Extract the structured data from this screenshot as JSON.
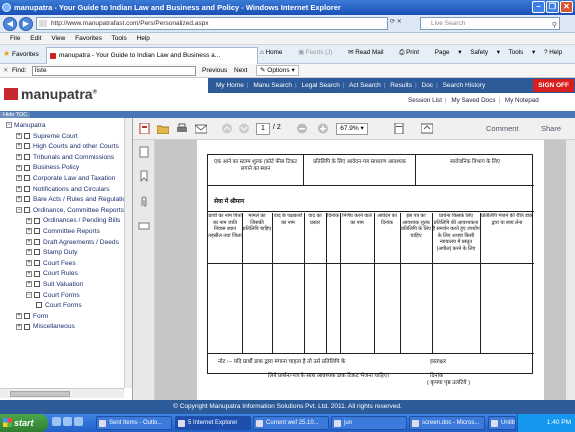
{
  "window": {
    "title": "manupatra - Your Guide to Indian Law and Business and Policy - Windows Internet Explorer"
  },
  "address": {
    "url": "http://www.manupatrafast.com/Pers/Personalized.aspx",
    "search_placeholder": "Live Search"
  },
  "menu": [
    "File",
    "Edit",
    "View",
    "Favorites",
    "Tools",
    "Help"
  ],
  "favorites_label": "Favorites",
  "tab": {
    "label": "manupatra - Your Guide to Indian Law and Business a..."
  },
  "commands": {
    "home": "Home",
    "feeds": "Feeds (J)",
    "read_mail": "Read Mail",
    "print": "Print",
    "page": "Page",
    "safety": "Safety",
    "tools": "Tools",
    "help": "Help"
  },
  "find": {
    "label": "Find:",
    "value": "liste",
    "previous": "Previous",
    "next": "Next",
    "options": "Options"
  },
  "site": {
    "logo": "manupatra",
    "nav": [
      "My Home",
      "Manu Search",
      "Legal Search",
      "Act Search",
      "Results",
      "Doc",
      "Search History"
    ],
    "sign_off": "SIGN OFF",
    "sublinks": [
      "Session List",
      "My Saved Docs",
      "My Notepad"
    ],
    "hide_toc": "Hide TOC"
  },
  "tree": [
    {
      "label": "Manupatra",
      "level": 0,
      "exp": "−",
      "cb": false
    },
    {
      "label": "Supreme Court",
      "level": 1,
      "exp": "+",
      "cb": true
    },
    {
      "label": "High Courts and other Courts",
      "level": 1,
      "exp": "+",
      "cb": true
    },
    {
      "label": "Tribunals and Commissions",
      "level": 1,
      "exp": "+",
      "cb": true
    },
    {
      "label": "Business Policy",
      "level": 1,
      "exp": "+",
      "cb": true
    },
    {
      "label": "Corporate Law and Taxation",
      "level": 1,
      "exp": "+",
      "cb": true
    },
    {
      "label": "Notifications and Circulars",
      "level": 1,
      "exp": "+",
      "cb": true
    },
    {
      "label": "Bare Acts / Rules and Regulations",
      "level": 1,
      "exp": "+",
      "cb": true
    },
    {
      "label": "Ordinance, Committee Reports",
      "level": 1,
      "exp": "−",
      "cb": true
    },
    {
      "label": "Ordinances / Pending Bills",
      "level": 2,
      "exp": "+",
      "cb": true
    },
    {
      "label": "Committee Reports",
      "level": 2,
      "exp": "+",
      "cb": true
    },
    {
      "label": "Draft Agreements / Deeds",
      "level": 2,
      "exp": "+",
      "cb": true
    },
    {
      "label": "Stamp Duty",
      "level": 2,
      "exp": "+",
      "cb": true
    },
    {
      "label": "Court Fees",
      "level": 2,
      "exp": "+",
      "cb": true
    },
    {
      "label": "Court Rules",
      "level": 2,
      "exp": "+",
      "cb": true
    },
    {
      "label": "Suit Valuation",
      "level": 2,
      "exp": "+",
      "cb": true
    },
    {
      "label": "Court Forms",
      "level": 2,
      "exp": "−",
      "cb": true
    },
    {
      "label": "Court Forms",
      "level": 3,
      "exp": "",
      "cb": true
    },
    {
      "label": "Form",
      "level": 1,
      "exp": "+",
      "cb": true
    },
    {
      "label": "Miscellaneous",
      "level": 1,
      "exp": "+",
      "cb": true
    }
  ],
  "pdf": {
    "page": "1",
    "total": "/ 2",
    "zoom": "67.9%",
    "comment": "Comment",
    "share": "Share"
  },
  "doc": {
    "h1": "एक आने का स्टाम्प शुल्क (कोर्ट फीस टिकट लगाने का स्थान",
    "h2": "प्रतिलिपि के लिए आवेदन-पत्र साधारण आवश्यक",
    "h3": "सार्वजनिक विभाग के लिए",
    "section": "सेवा में श्रीमान",
    "cols": [
      "प्रार्थी का नाम पिता का नाम जाति निवास स्थान तहसील तथा जिला",
      "मामले का जिसकी प्रतिलिपि चाहिए",
      "वाद के पक्षकारों का नाम",
      "वाद का प्रकार",
      "दिनांक",
      "निर्णय करने वाले का नाम",
      "आवेदन का दिनांक",
      "इस पत्र का आवश्यक शुल्क प्रतिलिपि के लिए चाहिए",
      "प्रार्थना किसके लिए प्रतिलिपि की आवश्यकता है समर्थन करते हुए उपयोग के लिए अथवा किसी न्यायालय में प्रस्तुत (अपील) करने के लिए",
      "प्रतिलिपि भेजने की रीति डाक द्वारा या स्वयं लेना"
    ],
    "note": "नोट :-- यदि प्रार्थी डाक द्वारा मंगाना चाहता है तो उसे प्रतिलिपि के",
    "note2": "लिये प्रार्थना-पत्र के साथ आवश्यक डाक टिकट भेजना चाहिए।",
    "sign": "हस्ताक्षर",
    "date": "दिनांक",
    "footer": "( कृपया पृष्ठ उलटिये )"
  },
  "copyright": "© Copyright Manupatra Information Solutions Pvt. Ltd. 2011. All rights reserved.",
  "taskbar": {
    "start": "start",
    "buttons": [
      "Sent Items - Outlo...",
      "5 Internet Explorer",
      "Current wef 25.10...",
      "jun",
      "screen.doc - Micros...",
      "Untitled - Paint"
    ],
    "clock": "1:40 PM"
  }
}
